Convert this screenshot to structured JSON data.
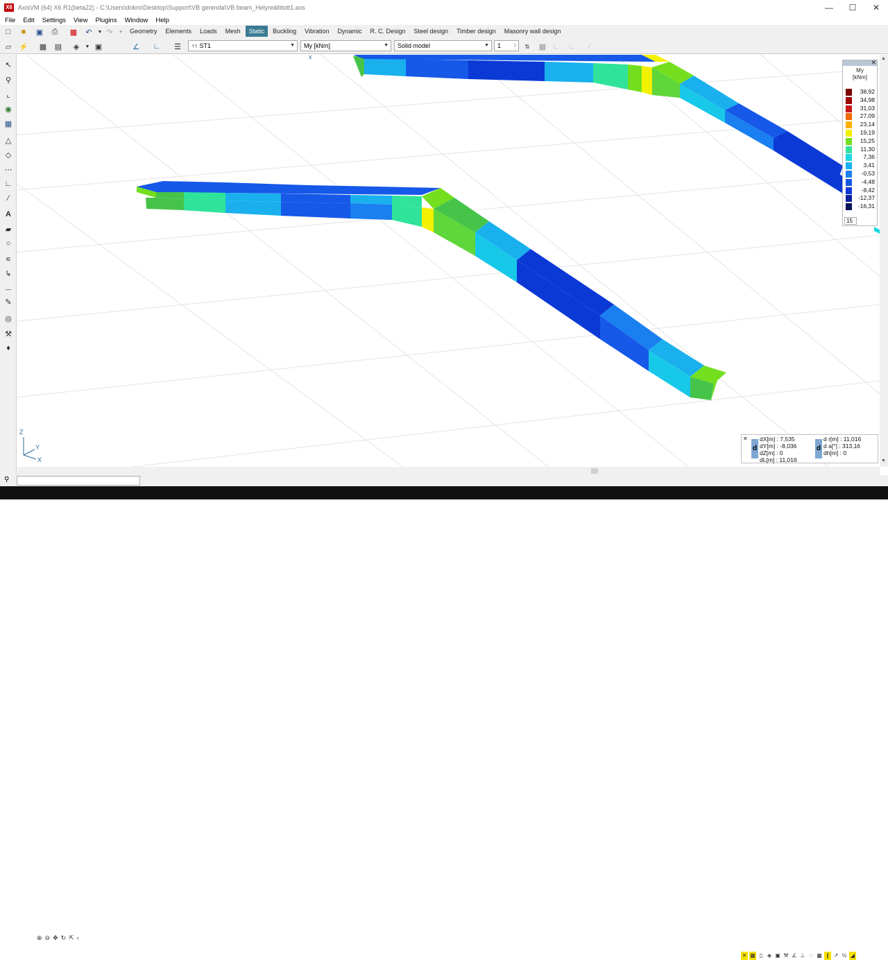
{
  "titlebar": {
    "app_badge": "X6",
    "title": "AxisVM (64) X6 R1(beta22) - C:\\Users\\dokro\\Desktop\\Support\\VB gerenda\\VB beam_Helyreállított1.axs",
    "minimize": "—",
    "maximize": "☐",
    "close": "✕"
  },
  "menu": [
    "File",
    "Edit",
    "Settings",
    "View",
    "Plugins",
    "Window",
    "Help"
  ],
  "tabs": [
    {
      "label": "Geometry",
      "active": false
    },
    {
      "label": "Elements",
      "active": false
    },
    {
      "label": "Loads",
      "active": false
    },
    {
      "label": "Mesh",
      "active": false
    },
    {
      "label": "Static",
      "active": true
    },
    {
      "label": "Buckling",
      "active": false
    },
    {
      "label": "Vibration",
      "active": false
    },
    {
      "label": "Dynamic",
      "active": false
    },
    {
      "label": "R. C. Design",
      "active": false
    },
    {
      "label": "Steel design",
      "active": false
    },
    {
      "label": "Timber design",
      "active": false
    },
    {
      "label": "Masonry wall design",
      "active": false
    }
  ],
  "toolbar2": {
    "loadcase": "ST1",
    "loadcase_prefix": "↑↑",
    "component": "My [kNm]",
    "display_mode": "Solid model",
    "spinner_value": "1"
  },
  "legend": {
    "title": "My",
    "unit": "[kNm]",
    "close": "✕",
    "step_value": "15",
    "entries": [
      {
        "value": "38,92",
        "color": "#7a0000"
      },
      {
        "value": "34,98",
        "color": "#9e0000"
      },
      {
        "value": "31,03",
        "color": "#c81a1a"
      },
      {
        "value": "27,09",
        "color": "#f06a00"
      },
      {
        "value": "23,14",
        "color": "#ffb000"
      },
      {
        "value": "19,19",
        "color": "#f3f000"
      },
      {
        "value": "15,25",
        "color": "#74df1e"
      },
      {
        "value": "11,30",
        "color": "#2fe39a"
      },
      {
        "value": "7,36",
        "color": "#1ad8e0"
      },
      {
        "value": "3,41",
        "color": "#18b0f0"
      },
      {
        "value": "-0,53",
        "color": "#1a7ff0"
      },
      {
        "value": "-4,48",
        "color": "#1658e8"
      },
      {
        "value": "-8,42",
        "color": "#0b39d6"
      },
      {
        "value": "-12,37",
        "color": "#0a229c"
      },
      {
        "value": "-16,31",
        "color": "#081256"
      }
    ]
  },
  "coords": {
    "close": "✕",
    "left_label": "d",
    "right_label": "d",
    "dx": "dX[m] : 7,535",
    "dy": "dY[m] : -8,036",
    "dz": "dZ[m] : 0",
    "dl": "dL[m] : 11,016",
    "dr": "d r[m] : 11,016",
    "da": "d a[°] : 313,16",
    "dh": "dh[m] : 0"
  },
  "axis": {
    "z": "Z",
    "y": "Y",
    "x": "X"
  }
}
